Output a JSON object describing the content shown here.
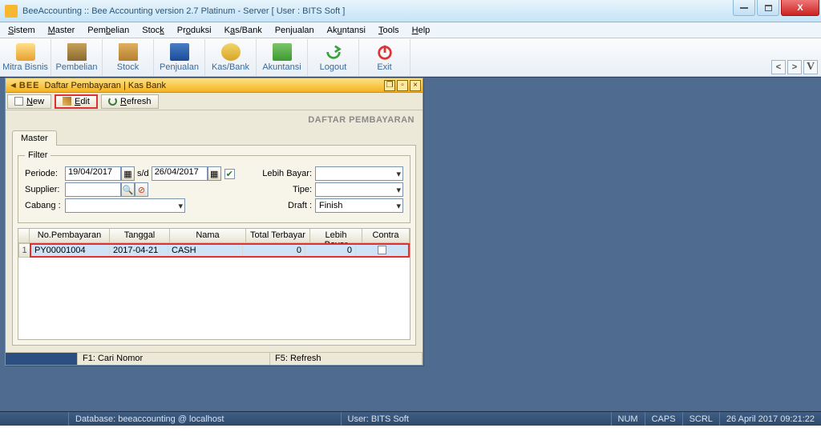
{
  "window": {
    "title": "BeeAccounting :: Bee Accounting version 2.7 Platinum - Server  [ User : BITS Soft ]"
  },
  "menubar": [
    "Sistem",
    "Master",
    "Pembelian",
    "Stock",
    "Produksi",
    "Kas/Bank",
    "Penjualan",
    "Akuntansi",
    "Tools",
    "Help"
  ],
  "toolbar": [
    "Mitra Bisnis",
    "Pembelian",
    "Stock",
    "Penjualan",
    "Kas/Bank",
    "Akuntansi",
    "Logout",
    "Exit"
  ],
  "right_v": "V",
  "subwin": {
    "title_app": "BEE",
    "title": "Daftar Pembayaran | Kas Bank",
    "actions": {
      "new": "New",
      "edit": "Edit",
      "refresh": "Refresh"
    },
    "page_title": "DAFTAR PEMBAYARAN",
    "tab": "Master",
    "filter": {
      "legend": "Filter",
      "periode_label": "Periode:",
      "periode_from": "19/04/2017",
      "periode_sep": "s/d",
      "periode_to": "26/04/2017",
      "check": "✔",
      "lebih_label": "Lebih Bayar:",
      "supplier_label": "Supplier:",
      "tipe_label": "Tipe:",
      "cabang_label": "Cabang :",
      "draft_label": "Draft :",
      "draft_val": "Finish"
    },
    "grid": {
      "headers": [
        "No.Pembayaran",
        "Tanggal",
        "Nama",
        "Total Terbayar",
        "Lebih Bayar",
        "Contra"
      ],
      "row": {
        "idx": "1",
        "no": "PY00001004",
        "tgl": "2017-04-21",
        "nama": "CASH",
        "total": "0",
        "lebih": "0",
        "contra": ""
      }
    },
    "substatus": {
      "f1": "F1: Cari Nomor",
      "f5": "F5: Refresh"
    }
  },
  "statusbar": {
    "db": "Database: beeaccounting @ localhost",
    "user": "User: BITS Soft",
    "num": "NUM",
    "caps": "CAPS",
    "scrl": "SCRL",
    "date": "26 April 2017  09:21:22"
  }
}
